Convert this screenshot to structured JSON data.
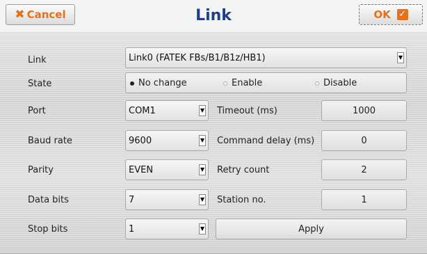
{
  "window": {
    "title": "Link"
  },
  "toolbar": {
    "cancel_label": "Cancel",
    "ok_label": "OK"
  },
  "link": {
    "label": "Link",
    "value": "Link0 (FATEK FBs/B1/B1z/HB1)"
  },
  "state": {
    "label": "State",
    "options": [
      "No change",
      "Enable",
      "Disable"
    ],
    "selected": "No change"
  },
  "port": {
    "label": "Port",
    "value": "COM1"
  },
  "baud_rate": {
    "label": "Baud rate",
    "value": "9600"
  },
  "parity": {
    "label": "Parity",
    "value": "EVEN"
  },
  "data_bits": {
    "label": "Data bits",
    "value": "7"
  },
  "stop_bits": {
    "label": "Stop bits",
    "value": "1"
  },
  "timeout": {
    "label": "Timeout (ms)",
    "value": "1000"
  },
  "command_delay": {
    "label": "Command delay (ms)",
    "value": "0"
  },
  "retry_count": {
    "label": "Retry count",
    "value": "2"
  },
  "station_no": {
    "label": "Station no.",
    "value": "1"
  },
  "apply": {
    "label": "Apply"
  },
  "colors": {
    "accent": "#e8701a",
    "title": "#1f3f8c"
  },
  "icons": {
    "cancel": "close-icon",
    "ok": "checkmark-icon",
    "dropdown": "dropdown-arrow-icon"
  }
}
